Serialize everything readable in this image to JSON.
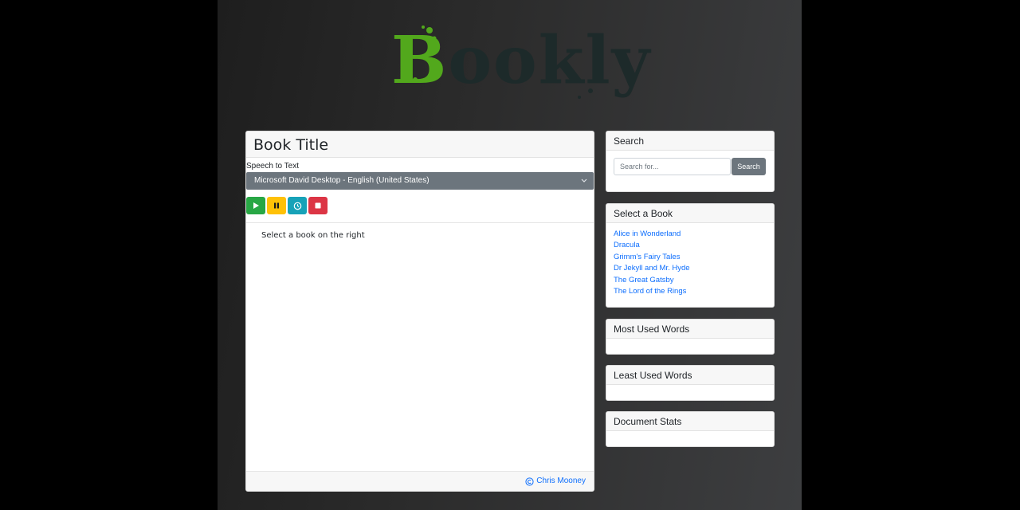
{
  "logo": {
    "text_first": "B",
    "text_rest": "ookly",
    "colors": {
      "first_letter": "#52a81c",
      "rest": "#1d2a2a"
    }
  },
  "main": {
    "title": "Book Title",
    "speech_label": "Speech to Text",
    "voice_selected": "Microsoft David Desktop - English (United States)",
    "controls": [
      {
        "name": "play",
        "icon": "play-icon",
        "color": "#28a745"
      },
      {
        "name": "pause",
        "icon": "pause-icon",
        "color": "#ffc107"
      },
      {
        "name": "timer",
        "icon": "clock-icon",
        "color": "#17a2b8"
      },
      {
        "name": "stop",
        "icon": "stop-icon",
        "color": "#dc3545"
      }
    ],
    "placeholder_text": "Select a book on the right",
    "footer_credit": "Chris Mooney",
    "footer_icon": "copyright-icon"
  },
  "sidebar": {
    "search": {
      "title": "Search",
      "placeholder": "Search for...",
      "button_label": "Search"
    },
    "books": {
      "title": "Select a Book",
      "items": [
        "Alice in Wonderland",
        "Dracula",
        "Grimm's Fairy Tales",
        "Dr Jekyll and Mr. Hyde",
        "The Great Gatsby",
        "The Lord of the Rings"
      ]
    },
    "most_used": {
      "title": "Most Used Words"
    },
    "least_used": {
      "title": "Least Used Words"
    },
    "stats": {
      "title": "Document Stats"
    }
  }
}
